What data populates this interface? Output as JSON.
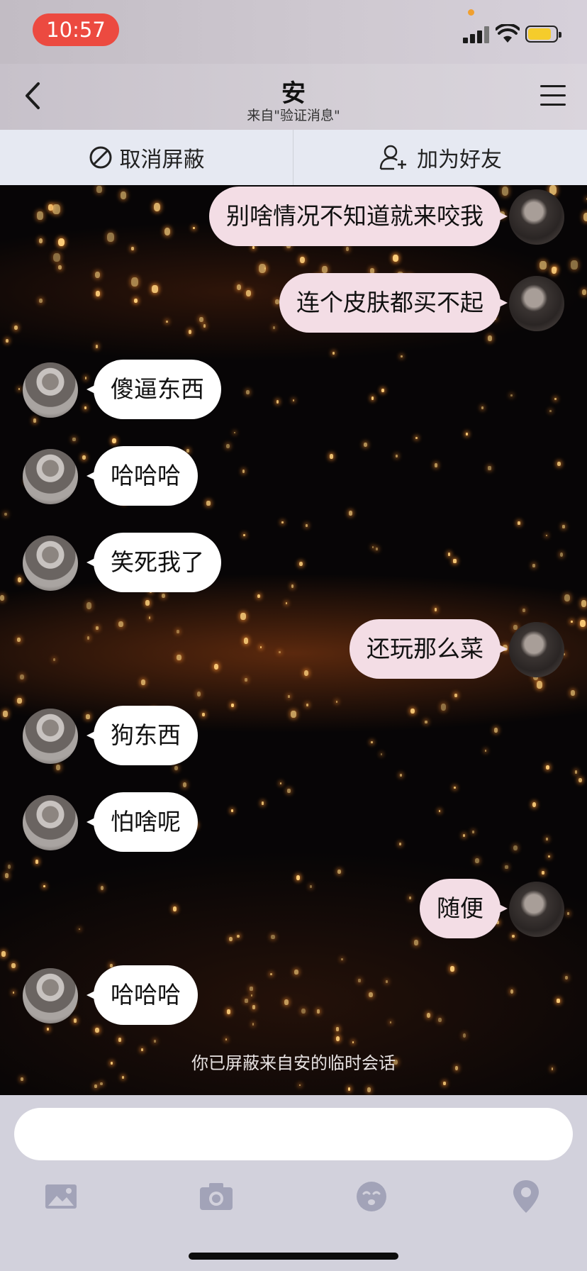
{
  "status_bar": {
    "time": "10:57"
  },
  "header": {
    "title": "安",
    "subtitle": "来自\"验证消息\""
  },
  "actions": {
    "unblock": "取消屏蔽",
    "add_friend": "加为好友"
  },
  "messages": [
    {
      "from": "me",
      "text": "别啥情况不知道就来咬我"
    },
    {
      "from": "me",
      "text": "连个皮肤都买不起"
    },
    {
      "from": "other",
      "text": "傻逼东西"
    },
    {
      "from": "other",
      "text": "哈哈哈"
    },
    {
      "from": "other",
      "text": "笑死我了"
    },
    {
      "from": "me",
      "text": "还玩那么菜"
    },
    {
      "from": "other",
      "text": "狗东西"
    },
    {
      "from": "other",
      "text": "怕啥呢"
    },
    {
      "from": "me",
      "text": "随便"
    },
    {
      "from": "other",
      "text": "哈哈哈"
    }
  ],
  "system_note": "你已屏蔽来自安的临时会话",
  "input": {
    "value": ""
  },
  "colors": {
    "time_pill": "#ec4a40",
    "my_bubble": "#f3dde5",
    "their_bubble": "#ffffff",
    "battery": "#f5cc2b"
  },
  "icons": [
    "image-icon",
    "camera-icon",
    "emoji-icon",
    "location-icon"
  ]
}
